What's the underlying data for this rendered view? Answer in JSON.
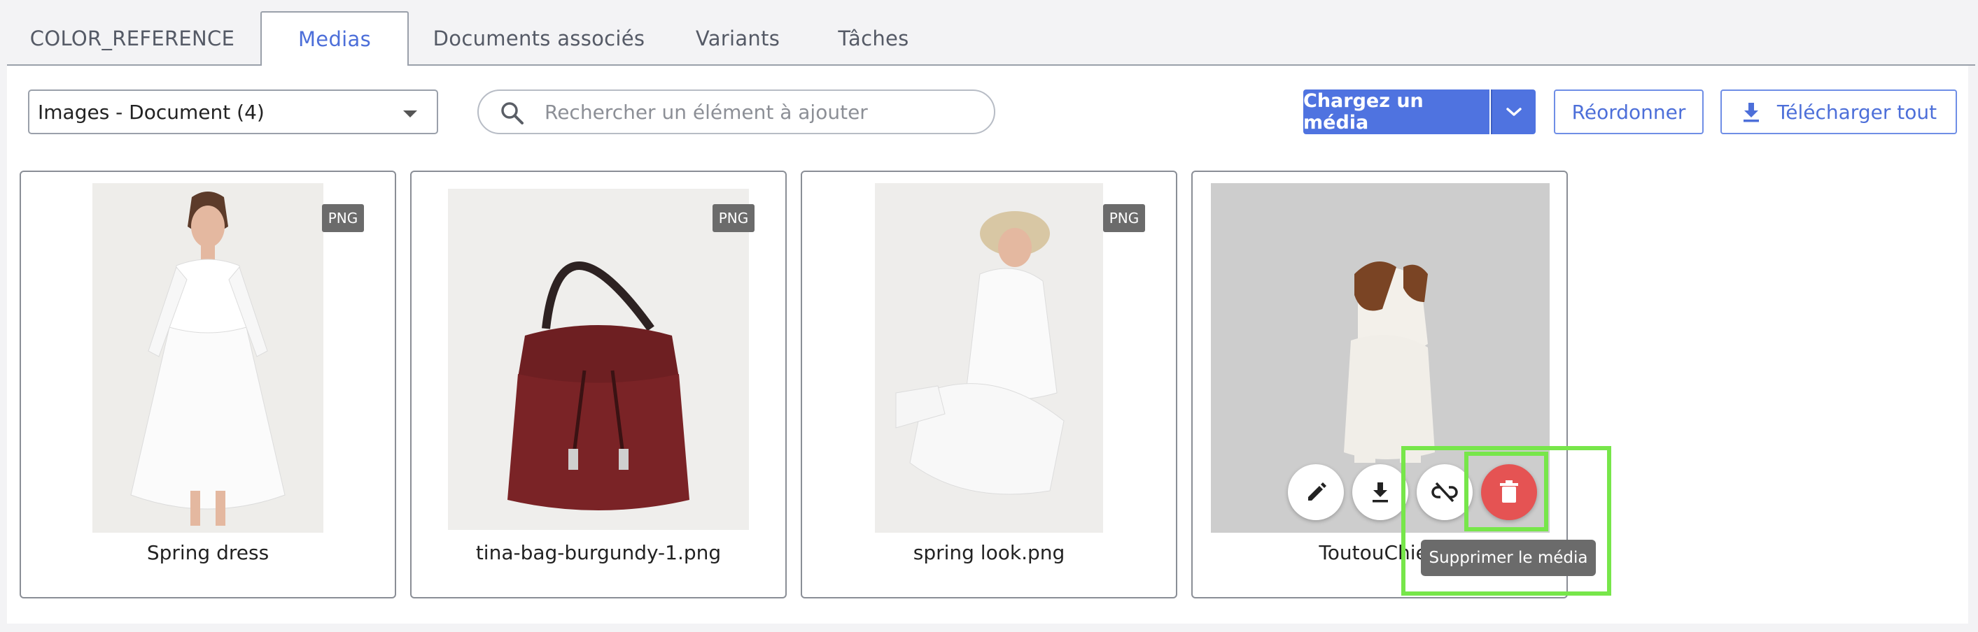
{
  "tabs": [
    {
      "label": "COLOR_REFERENCE"
    },
    {
      "label": "Medias"
    },
    {
      "label": "Documents associés"
    },
    {
      "label": "Variants"
    },
    {
      "label": "Tâches"
    }
  ],
  "toolbar": {
    "collection_select_value": "Images - Document (4)",
    "search_placeholder": "Rechercher un élément à ajouter",
    "upload_label": "Chargez un média",
    "reorder_label": "Réordonner",
    "download_all_label": "Télécharger tout"
  },
  "media": [
    {
      "name": "Spring dress",
      "format": "PNG"
    },
    {
      "name": "tina-bag-burgundy-1.png",
      "format": "PNG"
    },
    {
      "name": "spring look.png",
      "format": "PNG"
    },
    {
      "name": "ToutouChien"
    }
  ],
  "hover_actions": {
    "icons": [
      "edit-icon",
      "download-icon",
      "unlink-icon",
      "trash-icon"
    ],
    "tooltip": "Supprimer le média"
  },
  "colors": {
    "accent": "#4f73e0",
    "delete": "#e55353",
    "highlight": "#77e64a",
    "badge": "#6b6b6b"
  }
}
